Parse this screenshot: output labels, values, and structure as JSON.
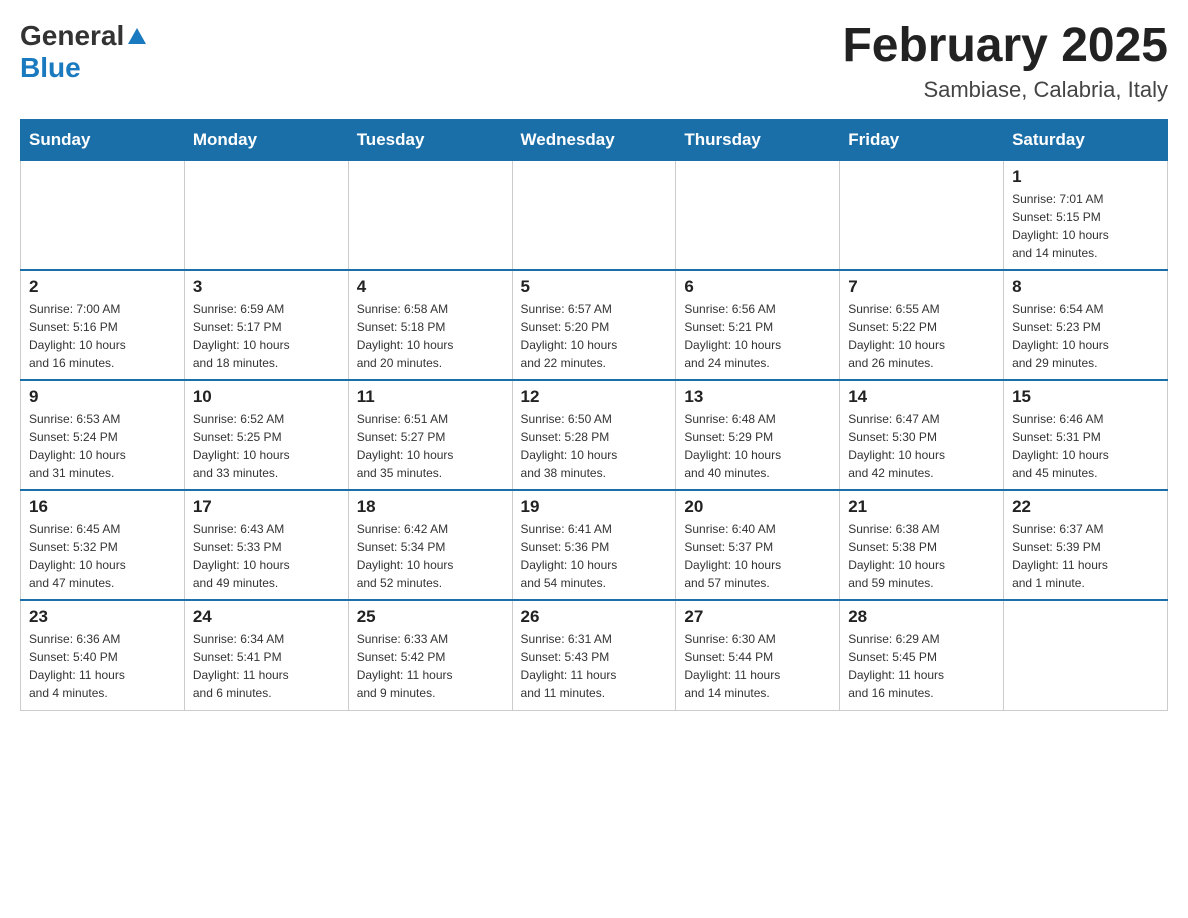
{
  "header": {
    "logo_general": "General",
    "logo_blue": "Blue",
    "month_title": "February 2025",
    "location": "Sambiase, Calabria, Italy"
  },
  "weekdays": [
    "Sunday",
    "Monday",
    "Tuesday",
    "Wednesday",
    "Thursday",
    "Friday",
    "Saturday"
  ],
  "weeks": [
    [
      {
        "day": "",
        "info": ""
      },
      {
        "day": "",
        "info": ""
      },
      {
        "day": "",
        "info": ""
      },
      {
        "day": "",
        "info": ""
      },
      {
        "day": "",
        "info": ""
      },
      {
        "day": "",
        "info": ""
      },
      {
        "day": "1",
        "info": "Sunrise: 7:01 AM\nSunset: 5:15 PM\nDaylight: 10 hours\nand 14 minutes."
      }
    ],
    [
      {
        "day": "2",
        "info": "Sunrise: 7:00 AM\nSunset: 5:16 PM\nDaylight: 10 hours\nand 16 minutes."
      },
      {
        "day": "3",
        "info": "Sunrise: 6:59 AM\nSunset: 5:17 PM\nDaylight: 10 hours\nand 18 minutes."
      },
      {
        "day": "4",
        "info": "Sunrise: 6:58 AM\nSunset: 5:18 PM\nDaylight: 10 hours\nand 20 minutes."
      },
      {
        "day": "5",
        "info": "Sunrise: 6:57 AM\nSunset: 5:20 PM\nDaylight: 10 hours\nand 22 minutes."
      },
      {
        "day": "6",
        "info": "Sunrise: 6:56 AM\nSunset: 5:21 PM\nDaylight: 10 hours\nand 24 minutes."
      },
      {
        "day": "7",
        "info": "Sunrise: 6:55 AM\nSunset: 5:22 PM\nDaylight: 10 hours\nand 26 minutes."
      },
      {
        "day": "8",
        "info": "Sunrise: 6:54 AM\nSunset: 5:23 PM\nDaylight: 10 hours\nand 29 minutes."
      }
    ],
    [
      {
        "day": "9",
        "info": "Sunrise: 6:53 AM\nSunset: 5:24 PM\nDaylight: 10 hours\nand 31 minutes."
      },
      {
        "day": "10",
        "info": "Sunrise: 6:52 AM\nSunset: 5:25 PM\nDaylight: 10 hours\nand 33 minutes."
      },
      {
        "day": "11",
        "info": "Sunrise: 6:51 AM\nSunset: 5:27 PM\nDaylight: 10 hours\nand 35 minutes."
      },
      {
        "day": "12",
        "info": "Sunrise: 6:50 AM\nSunset: 5:28 PM\nDaylight: 10 hours\nand 38 minutes."
      },
      {
        "day": "13",
        "info": "Sunrise: 6:48 AM\nSunset: 5:29 PM\nDaylight: 10 hours\nand 40 minutes."
      },
      {
        "day": "14",
        "info": "Sunrise: 6:47 AM\nSunset: 5:30 PM\nDaylight: 10 hours\nand 42 minutes."
      },
      {
        "day": "15",
        "info": "Sunrise: 6:46 AM\nSunset: 5:31 PM\nDaylight: 10 hours\nand 45 minutes."
      }
    ],
    [
      {
        "day": "16",
        "info": "Sunrise: 6:45 AM\nSunset: 5:32 PM\nDaylight: 10 hours\nand 47 minutes."
      },
      {
        "day": "17",
        "info": "Sunrise: 6:43 AM\nSunset: 5:33 PM\nDaylight: 10 hours\nand 49 minutes."
      },
      {
        "day": "18",
        "info": "Sunrise: 6:42 AM\nSunset: 5:34 PM\nDaylight: 10 hours\nand 52 minutes."
      },
      {
        "day": "19",
        "info": "Sunrise: 6:41 AM\nSunset: 5:36 PM\nDaylight: 10 hours\nand 54 minutes."
      },
      {
        "day": "20",
        "info": "Sunrise: 6:40 AM\nSunset: 5:37 PM\nDaylight: 10 hours\nand 57 minutes."
      },
      {
        "day": "21",
        "info": "Sunrise: 6:38 AM\nSunset: 5:38 PM\nDaylight: 10 hours\nand 59 minutes."
      },
      {
        "day": "22",
        "info": "Sunrise: 6:37 AM\nSunset: 5:39 PM\nDaylight: 11 hours\nand 1 minute."
      }
    ],
    [
      {
        "day": "23",
        "info": "Sunrise: 6:36 AM\nSunset: 5:40 PM\nDaylight: 11 hours\nand 4 minutes."
      },
      {
        "day": "24",
        "info": "Sunrise: 6:34 AM\nSunset: 5:41 PM\nDaylight: 11 hours\nand 6 minutes."
      },
      {
        "day": "25",
        "info": "Sunrise: 6:33 AM\nSunset: 5:42 PM\nDaylight: 11 hours\nand 9 minutes."
      },
      {
        "day": "26",
        "info": "Sunrise: 6:31 AM\nSunset: 5:43 PM\nDaylight: 11 hours\nand 11 minutes."
      },
      {
        "day": "27",
        "info": "Sunrise: 6:30 AM\nSunset: 5:44 PM\nDaylight: 11 hours\nand 14 minutes."
      },
      {
        "day": "28",
        "info": "Sunrise: 6:29 AM\nSunset: 5:45 PM\nDaylight: 11 hours\nand 16 minutes."
      },
      {
        "day": "",
        "info": ""
      }
    ]
  ]
}
